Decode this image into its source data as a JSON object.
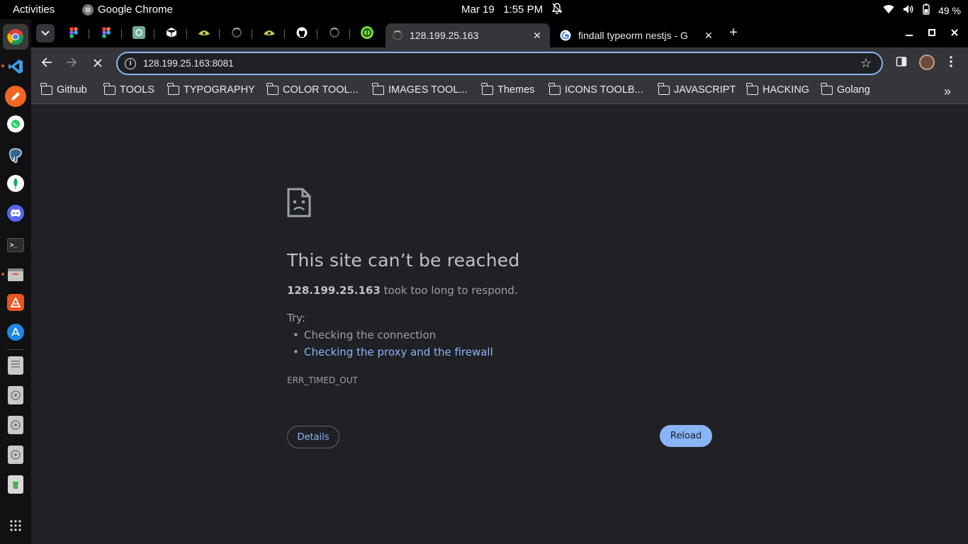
{
  "topbar": {
    "activities": "Activities",
    "app_name": "Google Chrome",
    "date": "Mar 19",
    "time": "1:55 PM",
    "battery": "49 %"
  },
  "dock": {
    "apps": [
      "chrome-icon",
      "vscode-icon",
      "pencil-app-icon",
      "whatsapp-icon",
      "postgres-icon",
      "mongodb-icon",
      "discord-icon",
      "terminal-icon",
      "files-icon",
      "software-center-icon",
      "app-store-icon",
      "drive-icon",
      "disc-icon",
      "disc-icon",
      "disc-icon",
      "trash-icon",
      "show-apps-icon"
    ]
  },
  "tabs": [
    {
      "title": "128.199.25.163",
      "active": true
    },
    {
      "title": "findall typeorm nestjs - G",
      "active": false
    }
  ],
  "omnibox": {
    "host": "128.199.25.163",
    "port": ":8081"
  },
  "bookmarks": [
    "Github",
    "TOOLS",
    "TYPOGRAPHY",
    "COLOR TOOL...",
    "IMAGES TOOL...",
    "Themes",
    "ICONS TOOLB...",
    "JAVASCRIPT",
    "HACKING",
    "Golang"
  ],
  "error": {
    "title": "This site can’t be reached",
    "host": "128.199.25.163",
    "message": " took too long to respond.",
    "try_label": "Try:",
    "suggestion_1": "Checking the connection",
    "suggestion_2": "Checking the proxy and the firewall",
    "code": "ERR_TIMED_OUT",
    "details_label": "Details",
    "reload_label": "Reload"
  },
  "colors": {
    "page_bg": "#202124",
    "toolbar_bg": "#35363a",
    "accent_blue": "#8ab4f8"
  }
}
